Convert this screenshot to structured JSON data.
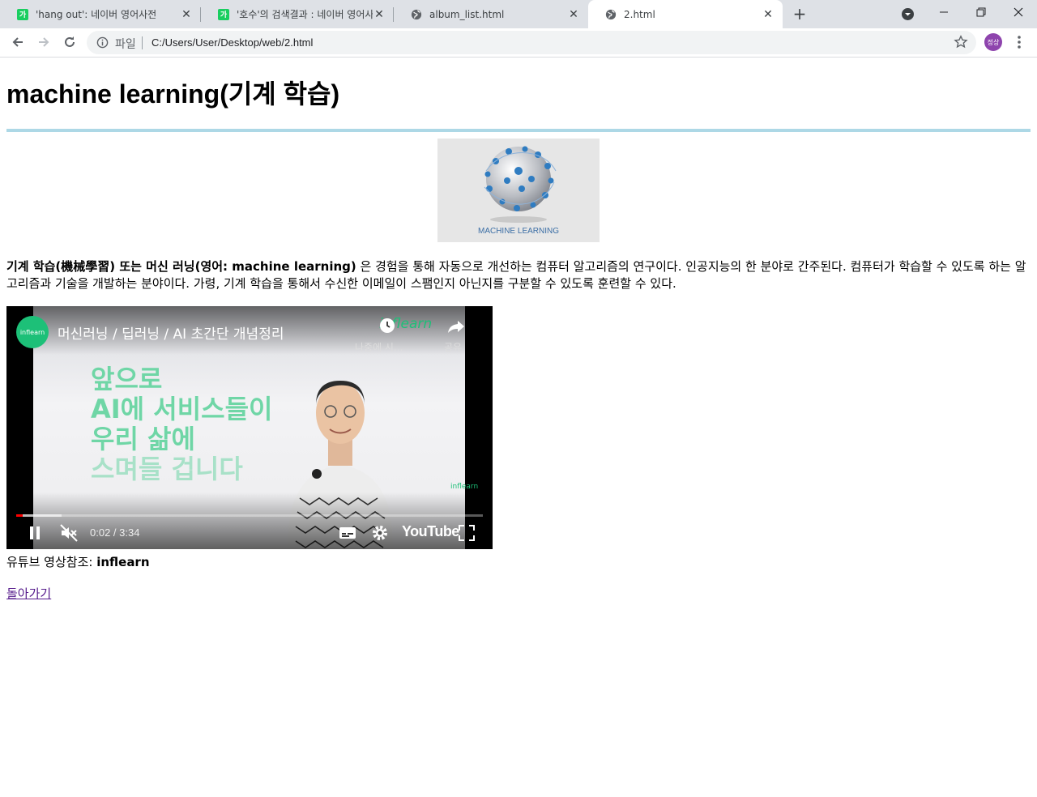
{
  "browser": {
    "tabs": [
      {
        "title": "'hang out': 네이버 영어사전",
        "favicon": "naver-icon",
        "favicon_label": "가",
        "active": false
      },
      {
        "title": "'호수'의 검색결과 : 네이버 영어사전",
        "favicon": "naver-icon",
        "favicon_label": "가",
        "active": false
      },
      {
        "title": "album_list.html",
        "favicon": "globe-icon",
        "active": false
      },
      {
        "title": "2.html",
        "favicon": "globe-icon",
        "active": true
      }
    ],
    "address": {
      "scheme_label": "파일",
      "url": "C:/Users/User/Desktop/web/2.html"
    },
    "profile_label": "정상"
  },
  "page": {
    "heading": "machine learning(기계 학습)",
    "hero_image_caption": "MACHINE LEARNING",
    "description": {
      "bold_lead": "기계 학습(機械學習) 또는 머신 러닝(영어: machine learning)",
      "rest": " 은 경험을 통해 자동으로 개선하는 컴퓨터 알고리즘의 연구이다. 인공지능의 한 분야로 간주된다. 컴퓨터가 학습할 수 있도록 하는 알고리즘과 기술을 개발하는 분야이다. 가령, 기계 학습을 통해서 수신한 이메일이 스팸인지 아닌지를 구분할 수 있도록 훈련할 수 있다."
    },
    "video": {
      "channel_logo_label": "inflearn",
      "title": "머신러닝 / 딥러닝 / AI 초간단 개념정리",
      "brand": "inflearn",
      "watch_later": "나중에 시...",
      "share": "공유",
      "slogan_lines": [
        "앞으로",
        "AI에 서비스들이",
        "우리 삶에",
        "스며들 겁니다"
      ],
      "watermark": "inflearn",
      "time": "0:02 / 3:34",
      "progress_fraction": 0.014,
      "youtube_label": "YouTube"
    },
    "credit": {
      "prefix": "유튜브 영상참조: ",
      "source": "inflearn"
    },
    "back_link": "돌아가기"
  },
  "colors": {
    "rule": "#add8e6",
    "naver": "#19ce60",
    "inflearn": "#1dc078",
    "visited_link": "#551a8b"
  }
}
